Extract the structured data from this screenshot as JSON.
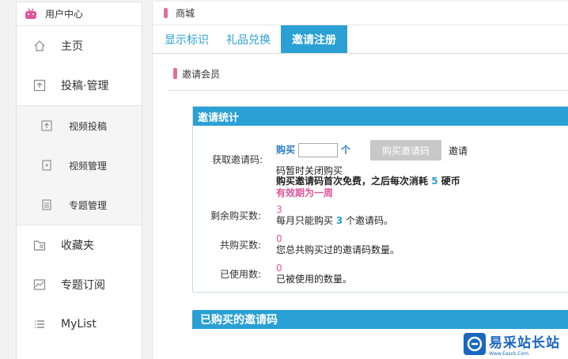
{
  "sidebar": {
    "header": "用户中心",
    "items": [
      {
        "label": "主页",
        "icon": "home-icon"
      },
      {
        "label": "投稿·管理",
        "icon": "upload-icon"
      }
    ],
    "sub_items": [
      {
        "label": "视频投稿",
        "icon": "video-upload-icon"
      },
      {
        "label": "视频管理",
        "icon": "video-manage-icon"
      },
      {
        "label": "专题管理",
        "icon": "topic-manage-icon"
      }
    ],
    "items_after": [
      {
        "label": "收藏夹",
        "icon": "folder-icon"
      },
      {
        "label": "专题订阅",
        "icon": "chart-icon"
      },
      {
        "label": "MyList",
        "icon": "list-icon"
      }
    ]
  },
  "main": {
    "header": "商城",
    "tabs": [
      {
        "label": "显示标识"
      },
      {
        "label": "礼品兑换"
      },
      {
        "label": "邀请注册"
      }
    ],
    "section_title": "邀请会员",
    "stats": {
      "title": "邀请统计",
      "get_label": "获取邀请码:",
      "buy_prefix": "购买",
      "buy_unit": "个",
      "buy_button": "购买邀请码",
      "invite_word": "邀请",
      "closed_line": "码暂时关闭购买",
      "note_prefix": "购买邀请码首次免费，之后每次消耗",
      "note_cost": "5",
      "note_suffix": "硬币",
      "validity": "有效期为一周",
      "remaining_label": "剩余购买数:",
      "remaining_value": "3",
      "remaining_desc_prefix": "每月只能购买",
      "remaining_desc_num": "3",
      "remaining_desc_suffix": "个邀请码。",
      "total_label": "共购买数:",
      "total_value": "0",
      "total_desc": "您总共购买过的邀请码数量。",
      "used_label": "已使用数:",
      "used_value": "0",
      "used_desc": "已被使用的数量。"
    },
    "purchased_title": "已购买的邀请码"
  },
  "watermark": {
    "text": "易采站长站",
    "subtext": "Www.Easck.Com"
  },
  "colors": {
    "accent": "#2aa0d4",
    "pink": "#e0569a"
  }
}
